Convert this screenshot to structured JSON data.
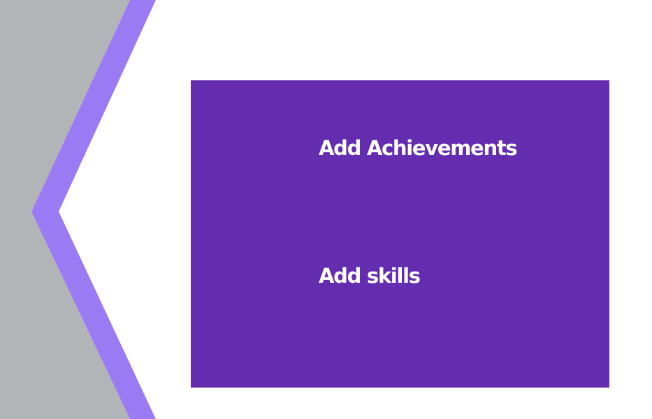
{
  "colors": {
    "background": "#ffffff",
    "gray_band": "#b1b5b8",
    "violet_stripe": "#9b7bf4",
    "panel": "#642caf",
    "panel_text": "#ffffff"
  },
  "panel": {
    "items": [
      {
        "label": "Add Achievements"
      },
      {
        "label": "Add skills"
      }
    ]
  }
}
